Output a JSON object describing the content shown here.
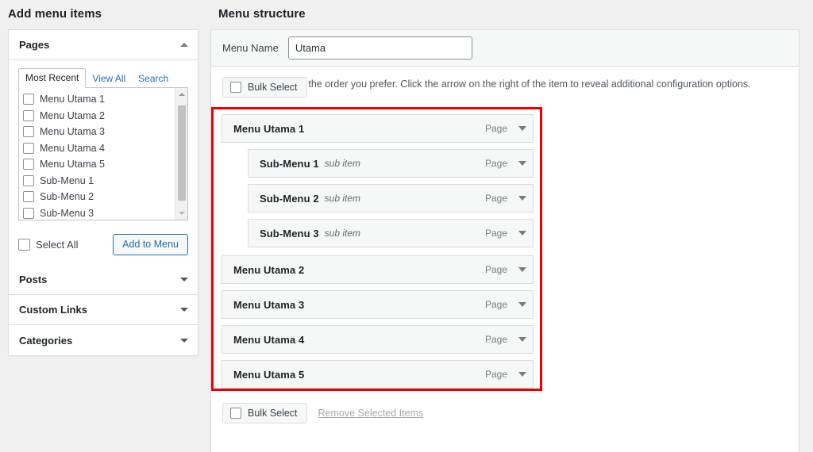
{
  "left": {
    "heading": "Add menu items",
    "pages_panel": {
      "title": "Pages",
      "collapse_icon": "triangle-up-icon",
      "tabs": [
        {
          "label": "Most Recent",
          "active": true
        },
        {
          "label": "View All",
          "active": false
        },
        {
          "label": "Search",
          "active": false
        }
      ],
      "items": [
        "Menu Utama 1",
        "Menu Utama 2",
        "Menu Utama 3",
        "Menu Utama 4",
        "Menu Utama 5",
        "Sub-Menu 1",
        "Sub-Menu 2",
        "Sub-Menu 3"
      ],
      "select_all_label": "Select All",
      "add_button_label": "Add to Menu",
      "scrollbar": {
        "up_icon": "scroll-up-arrow-icon",
        "down_icon": "scroll-down-arrow-icon"
      }
    },
    "accordions": [
      {
        "label": "Posts",
        "icon": "triangle-down-icon"
      },
      {
        "label": "Custom Links",
        "icon": "triangle-down-icon"
      },
      {
        "label": "Categories",
        "icon": "triangle-down-icon"
      }
    ]
  },
  "right": {
    "heading": "Menu structure",
    "menu_name_label": "Menu Name",
    "menu_name_value": "Utama",
    "menu_name_placeholder": "Menu Name",
    "drag_hint": "Drag the items into the order you prefer. Click the arrow on the right of the item to reveal additional configuration options.",
    "bulk_select_top_label": "Bulk Select",
    "bulk_select_bottom_label": "Bulk Select",
    "remove_selected_label": "Remove Selected Items",
    "highlight_color": "#ee0000",
    "menu_items": [
      {
        "title": "Menu Utama 1",
        "sub_tag": "",
        "type": "Page",
        "level": 0
      },
      {
        "title": "Sub-Menu 1",
        "sub_tag": "sub item",
        "type": "Page",
        "level": 1
      },
      {
        "title": "Sub-Menu 2",
        "sub_tag": "sub item",
        "type": "Page",
        "level": 1
      },
      {
        "title": "Sub-Menu 3",
        "sub_tag": "sub item",
        "type": "Page",
        "level": 1
      },
      {
        "title": "Menu Utama 2",
        "sub_tag": "",
        "type": "Page",
        "level": 0
      },
      {
        "title": "Menu Utama 3",
        "sub_tag": "",
        "type": "Page",
        "level": 0
      },
      {
        "title": "Menu Utama 4",
        "sub_tag": "",
        "type": "Page",
        "level": 0
      },
      {
        "title": "Menu Utama 5",
        "sub_tag": "",
        "type": "Page",
        "level": 0
      }
    ]
  },
  "colors": {
    "accent": "#2271b1",
    "page_bg": "#f0f0f1",
    "panel_bg": "#ffffff",
    "row_bg": "#f6f7f7",
    "border": "#dcdcde",
    "highlight": "#ee0000"
  }
}
